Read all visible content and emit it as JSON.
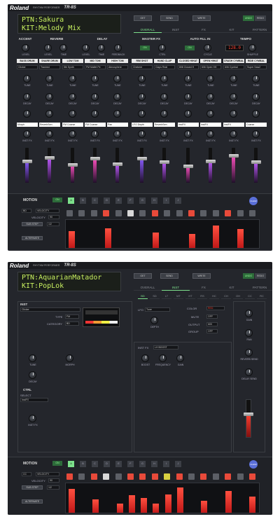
{
  "brand": "Roland",
  "subtitle": "RHYTHM PERFORMER",
  "model": "TR-8S",
  "toolbar": {
    "get": "GET",
    "send": "SEND",
    "write": "WRITE",
    "undo": "UNDO",
    "redo": "REDO"
  },
  "tabs": [
    "OVERALL",
    "INST",
    "FX",
    "KIT",
    "PATTERN"
  ],
  "screen1": {
    "lcd_line1": "PTN:Sakura",
    "lcd_line2": "KIT:Melody Mix",
    "active_tab": "OVERALL",
    "sections": [
      "ACCENT",
      "REVERB",
      "DELAY",
      "MASTER FX",
      "AUTO FILL IN",
      "TEMPO"
    ],
    "knob_labels": {
      "level": "LEVEL",
      "time": "TIME",
      "feedback": "FEEDBACK",
      "ctrl": "CTRL",
      "cycle": "CYCLE",
      "shuffle": "SHUFFLE",
      "tune": "TUNE",
      "decay": "DECAY",
      "inst_fx": "INST FX"
    },
    "on_label": "ON",
    "tempo_value": "128.0",
    "tracks": [
      {
        "name": "BASS DRUM",
        "inst": "Clicker",
        "ctrl": "Morph"
      },
      {
        "name": "SNARE DRUM",
        "inst": "Trashed",
        "ctrl": "ReverbSen"
      },
      {
        "name": "LOW TOM",
        "inst": "5th Synth",
        "ctrl": "FM Coarse"
      },
      {
        "name": "MID TOM",
        "inst": "FM Mallet Pe",
        "ctrl": "FM Coarse"
      },
      {
        "name": "HIGH TOM",
        "inst": "Atmosphere",
        "ctrl": "Pan"
      },
      {
        "name": "RIM SHOT",
        "inst": "Chekere",
        "ctrl": "LFO Depth"
      },
      {
        "name": "HAND CLAP",
        "inst": "Claps Real",
        "ctrl": "ReverbSen"
      },
      {
        "name": "CLOSED HIHAT",
        "inst": "808 Closed H",
        "ctrl": "InstFX"
      },
      {
        "name": "OPEN HIHAT",
        "inst": "606 Open HH",
        "ctrl": "InstFX"
      },
      {
        "name": "CRASH CYMBAL",
        "inst": "606 Cymbal",
        "ctrl": "InstFX"
      },
      {
        "name": "RIDE CYMBAL",
        "inst": "Super Saw2",
        "ctrl": "Coarse"
      }
    ],
    "fader_levels": [
      0.62,
      0.72,
      0.52,
      0.7,
      0.55,
      0.7,
      0.6,
      0.48,
      0.62,
      0.78,
      0.6
    ],
    "fader_colors": [
      "#8a5cff",
      "#c05cff",
      "#ff50c0",
      "#ff50c0",
      "#c05cff",
      "#8a5cff",
      "#c05cff",
      "#ff50c0",
      "#c05cff",
      "#ff50c0",
      "#c05cff"
    ],
    "motion": {
      "title": "MOTION",
      "on": "ON",
      "steps": [
        "A",
        "B",
        "C",
        "D",
        "E",
        "F",
        "G",
        "H",
        "I",
        "J"
      ],
      "inst_select": "BD",
      "param_select": "VELOCITY",
      "velocity_label": "VELOCITY",
      "velocity_value": "90",
      "sub_step_label": "SUB STEP",
      "sub_step_value": "1/2",
      "alternate": "ALTERNATE",
      "clear": "CLEAR",
      "pads": [
        "dark",
        "dark",
        "dark",
        "red",
        "dark",
        "light",
        "dark",
        "red",
        "dark",
        "dark",
        "red",
        "dark",
        "dark",
        "red",
        "dark",
        "dark"
      ],
      "bars": [
        0.6,
        0,
        0,
        0.7,
        0,
        0,
        0,
        0.55,
        0,
        0,
        0.5,
        0,
        0.8,
        0,
        0.68,
        0
      ]
    }
  },
  "screen2": {
    "lcd_line1": "PTN:AquarianMatador",
    "lcd_line2": "KIT:PopLok",
    "active_tab": "INST",
    "inst_tabs": [
      "BD",
      "SD",
      "LT",
      "MT",
      "HT",
      "RS",
      "HC",
      "CH",
      "OH",
      "CC",
      "RC"
    ],
    "inst": {
      "title": "INST",
      "name": "Clicker",
      "type_label": "TYPE",
      "type": "FM",
      "category_label": "CATEGORY",
      "category": "BD"
    },
    "lfo": {
      "label": "LFO",
      "value": "Tune",
      "depth": "DEPTH"
    },
    "color": {
      "label": "COLOR",
      "value": "RED"
    },
    "mute": {
      "label": "MUTE",
      "value": "OFF"
    },
    "output": {
      "label": "OUTPUT",
      "value": "MIX"
    },
    "group": {
      "label": "GROUP",
      "value": "OFF"
    },
    "right_knobs": [
      "GAIN",
      "PAN",
      "REVERB SEND",
      "DELAY SEND"
    ],
    "left_knobs": [
      "TUNE",
      "DECAY"
    ],
    "morph": "MORPH",
    "ctrl": {
      "title": "CTRL",
      "select_label": "SELECT",
      "value": "InstFX"
    },
    "inst_fx_knob": "INST FX",
    "inst_fx": {
      "label": "INST FX",
      "value": "LH BOOST",
      "knobs": [
        "BOOST",
        "FREQUENCY",
        "GAIN"
      ]
    },
    "fader_level": 0.62,
    "motion": {
      "title": "MOTION",
      "on": "ON",
      "steps": [
        "A",
        "B",
        "C",
        "D",
        "E",
        "F",
        "G",
        "H",
        "I",
        "J"
      ],
      "inst_select": "CC",
      "param_select": "VELOCITY",
      "velocity_label": "VELOCITY",
      "velocity_value": "90",
      "sub_step_label": "SUB STEP",
      "sub_step_value": "1/2",
      "alternate": "ALTERNATE",
      "clear": "CLEAR",
      "pads": [
        "red",
        "dark",
        "red",
        "light",
        "dark",
        "red",
        "red",
        "red",
        "yel",
        "red",
        "dark",
        "red",
        "dark",
        "red",
        "dark",
        "red"
      ],
      "bars": [
        0.8,
        0,
        0.45,
        0,
        0.3,
        0.6,
        0.5,
        0.3,
        0.62,
        0.85,
        0,
        0.4,
        0,
        0.75,
        0,
        0.55
      ]
    }
  }
}
